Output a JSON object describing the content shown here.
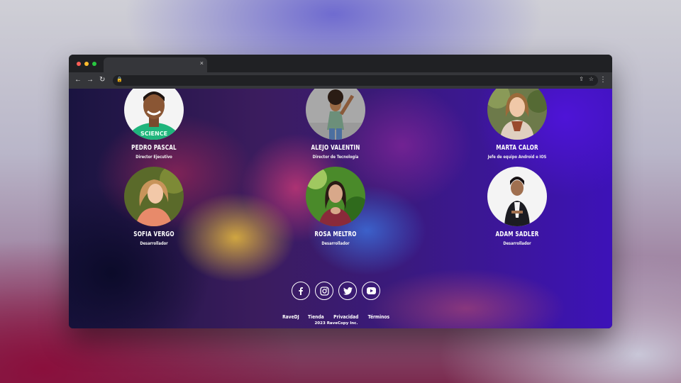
{
  "browser": {
    "tab_close": "×",
    "nav": {
      "back": "←",
      "forward": "→",
      "reload": "↻"
    },
    "omnibox": {
      "lock": "🔒",
      "share": "⇪",
      "star": "☆"
    },
    "menu": "⋮"
  },
  "team": [
    {
      "name": "PEDRO PASCAL",
      "role": "Director Ejecutivo"
    },
    {
      "name": "ALEJO VALENTIN",
      "role": "Director de Tecnología"
    },
    {
      "name": "MARTA CALOR",
      "role": "Jefe de equipo Android e IOS"
    },
    {
      "name": "SOFIA VERGO",
      "role": "Desarrollador"
    },
    {
      "name": "ROSA MELTRO",
      "role": "Desarrollador"
    },
    {
      "name": "ADAM SADLER",
      "role": "Desarrollador"
    }
  ],
  "social": [
    "facebook-icon",
    "instagram-icon",
    "twitter-icon",
    "youtube-icon"
  ],
  "footer": {
    "links": [
      "RaveDJ",
      "Tienda",
      "Privacidad",
      "Términos"
    ],
    "copyright": "2023 RaveCopy Inc."
  },
  "colors": {
    "window_bg": "#202124",
    "toolbar_bg": "#35363a",
    "dot_red": "#ff5f57",
    "dot_yellow": "#febc2e",
    "dot_green": "#28c840"
  }
}
